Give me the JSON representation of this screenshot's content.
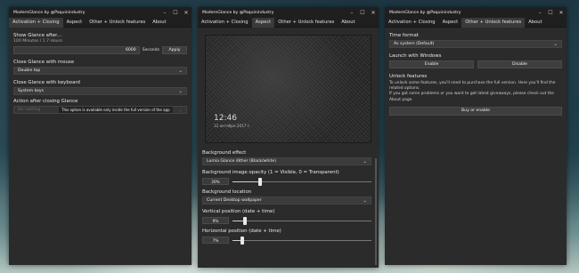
{
  "windows": [
    {
      "title": "ModernGlance by @Paquinindustry",
      "tabs": [
        "Activation + Closing",
        "Aspect",
        "Other + Unlock features",
        "About"
      ],
      "active_tab": 0,
      "show_glance": {
        "label": "Show Glance after...",
        "sublabel": "100 Minutes / 1.7 Hours",
        "value": "6000",
        "unit": "Seconds",
        "apply_label": "Apply"
      },
      "close_mouse": {
        "label": "Close Glance with mouse",
        "value": "Double tap"
      },
      "close_keyboard": {
        "label": "Close Glance with keyboard",
        "value": "System keys"
      },
      "action_after": {
        "label": "Action after closing Glance",
        "value": "Do nothing",
        "note": "This option is available only inside the full version of the app"
      }
    },
    {
      "title": "ModernGlance by @Paquinindustry",
      "tabs": [
        "Activation + Closing",
        "Aspect",
        "Other + Unlock features",
        "About"
      ],
      "active_tab": 1,
      "preview": {
        "time": "12:46",
        "date": "12 октября 2017 г."
      },
      "background_effect": {
        "label": "Background effect",
        "value": "Lumia Glance dither (Black/white)"
      },
      "opacity": {
        "label": "Background image opacity (1 = Visible, 0 = Transparent)",
        "value": "20%",
        "level": 0.2
      },
      "location": {
        "label": "Background location",
        "value": "Current Desktop wallpaper"
      },
      "vertical": {
        "label": "Vertical position (date + time)",
        "value": "9%",
        "level": 0.09
      },
      "horizontal": {
        "label": "Horizontal position (date + time)",
        "value": "7%",
        "level": 0.07
      }
    },
    {
      "title": "ModernGlance by @Paquinindustry",
      "tabs": [
        "Activation + Closing",
        "Aspect",
        "Other + Unlock features",
        "About"
      ],
      "active_tab": 2,
      "time_format": {
        "label": "Time format",
        "value": "As system (Default)"
      },
      "launch": {
        "label": "Launch with Windows",
        "enable": "Enable",
        "disable": "Disable"
      },
      "unlock": {
        "label": "Unlock features",
        "line1": "To unlock some features, you'll need to purchase the full version. Here you'll find the related options.",
        "line2": "If you got some problems or you want to get latest giveaways, please check out the About page.",
        "button": "Buy or enable"
      }
    }
  ]
}
